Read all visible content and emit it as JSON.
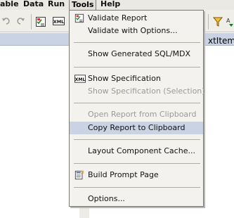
{
  "menubar": {
    "items": [
      {
        "label": "able"
      },
      {
        "label": "Data"
      },
      {
        "label": "Run"
      },
      {
        "label": "Tools"
      },
      {
        "label": "Help"
      }
    ]
  },
  "strip": {
    "text": "xtItem"
  },
  "menu": {
    "items": [
      {
        "label": "Validate Report",
        "icon": "validate-icon"
      },
      {
        "label": "Validate with Options..."
      },
      {
        "label": "Show Generated SQL/MDX"
      },
      {
        "label": "Show Specification",
        "icon": "xml-icon"
      },
      {
        "label": "Show Specification (Selection)",
        "disabled": true
      },
      {
        "label": "Open Report from Clipboard",
        "disabled": true
      },
      {
        "label": "Copy Report to Clipboard",
        "highlighted": true
      },
      {
        "label": "Layout Component Cache..."
      },
      {
        "label": "Build Prompt Page",
        "icon": "prompt-page-icon"
      },
      {
        "label": "Options..."
      }
    ]
  },
  "icons": {
    "toolbar": [
      "undo-icon",
      "redo-icon",
      "validate-icon",
      "xml-icon",
      "filter-icon",
      "sort-icon"
    ]
  },
  "colors": {
    "menu_bg": "#f3f2ee",
    "highlight": "#c9d3e3",
    "disabled_text": "#9b9a95"
  }
}
